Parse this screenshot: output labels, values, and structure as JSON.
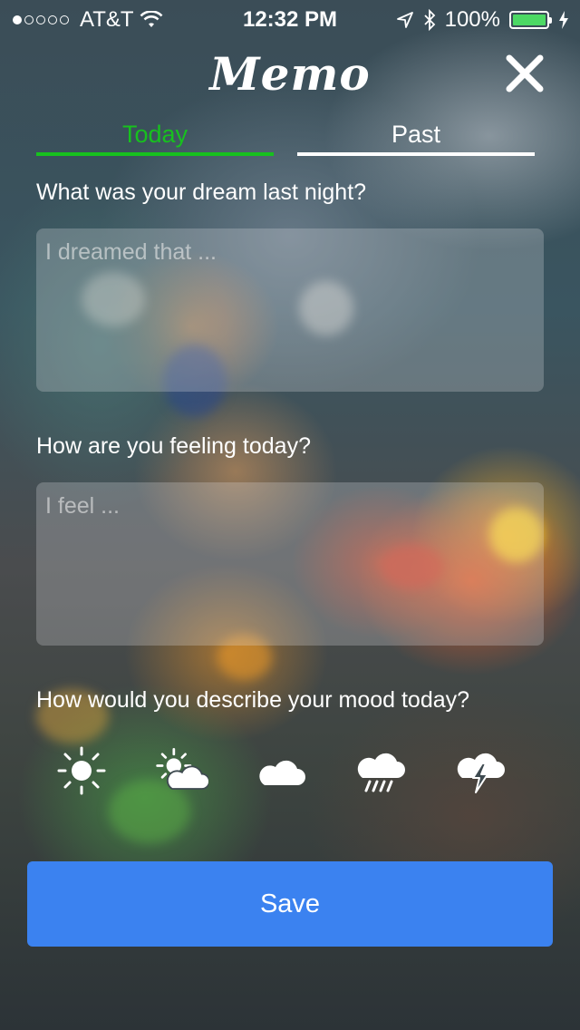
{
  "status": {
    "carrier": "AT&T",
    "time": "12:32 PM",
    "battery": "100%",
    "battery_color": "#4cd964"
  },
  "header": {
    "title": "Memo",
    "close_icon": "close-icon"
  },
  "tabs": [
    {
      "label": "Today",
      "active": true,
      "color": "#17c11e"
    },
    {
      "label": "Past",
      "active": false,
      "color": "#ffffff"
    }
  ],
  "questions": {
    "dream": {
      "label": "What was your dream last night?",
      "placeholder": "I dreamed that ..."
    },
    "feeling": {
      "label": "How are you feeling today?",
      "placeholder": "I feel ..."
    },
    "mood": {
      "label": "How would you describe your mood today?"
    }
  },
  "moods": [
    "sunny-icon",
    "partly-cloudy-icon",
    "cloudy-icon",
    "rainy-icon",
    "thunderstorm-icon"
  ],
  "save_button": {
    "label": "Save",
    "color": "#3b82f0"
  }
}
